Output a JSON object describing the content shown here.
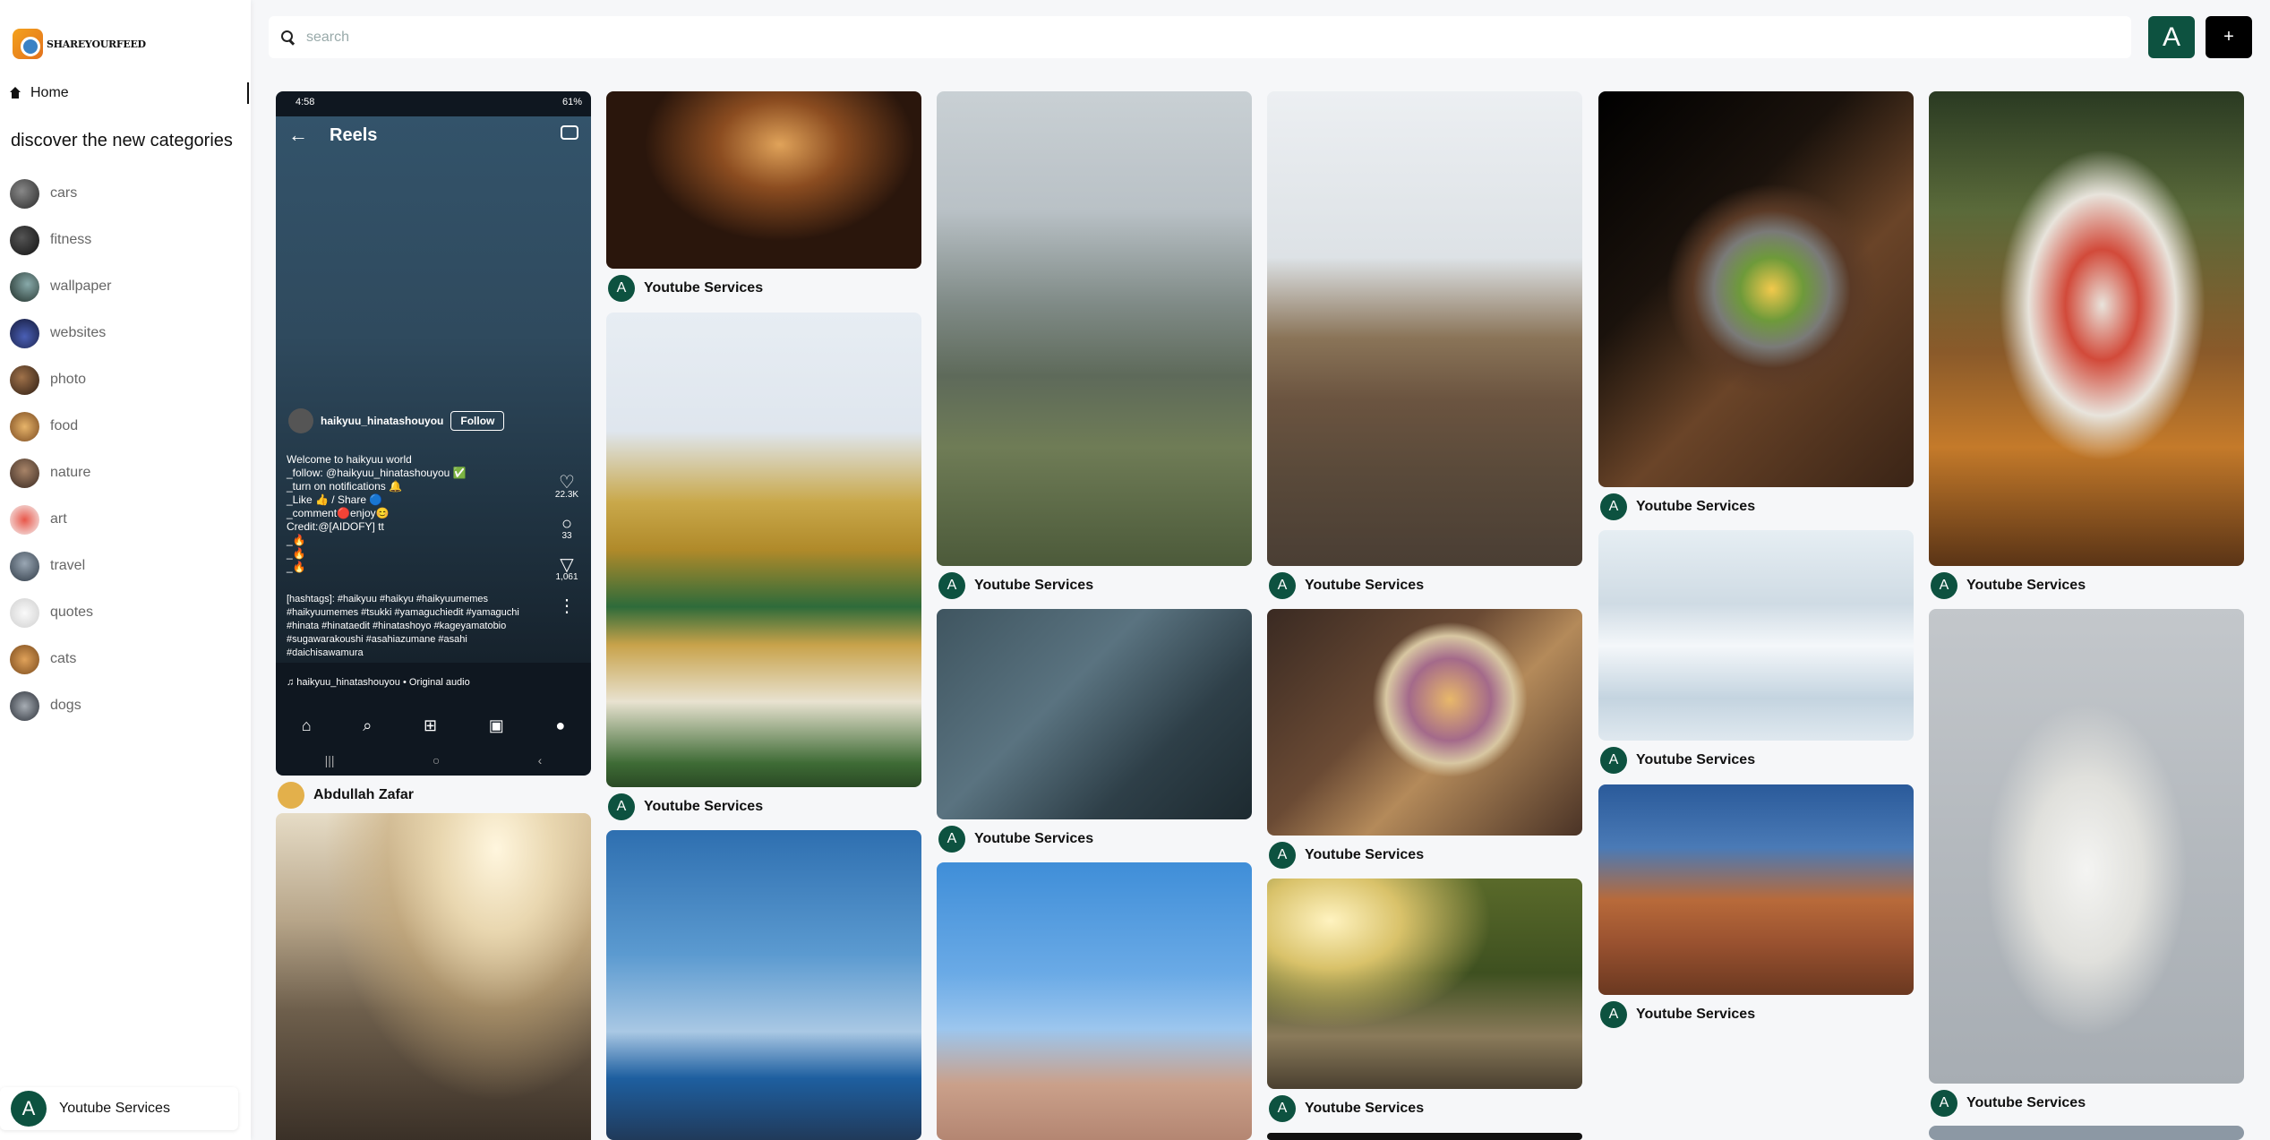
{
  "app": {
    "logo_text": "SHAREYOURFEED"
  },
  "nav": {
    "home_label": "Home"
  },
  "sidebar": {
    "discover_title": "discover the new categories",
    "categories": [
      {
        "label": "cars",
        "color": "#4a4a4a"
      },
      {
        "label": "fitness",
        "color": "#2b2b2b"
      },
      {
        "label": "wallpaper",
        "color": "#3d5a4a"
      },
      {
        "label": "websites",
        "color": "#25305e"
      },
      {
        "label": "photo",
        "color": "#5b3a2a"
      },
      {
        "label": "food",
        "color": "#b7793b"
      },
      {
        "label": "nature",
        "color": "#6a4a3a"
      },
      {
        "label": "art",
        "color": "#c0392b"
      },
      {
        "label": "travel",
        "color": "#4a5a6a"
      },
      {
        "label": "quotes",
        "color": "#e6e6e6"
      },
      {
        "label": "cats",
        "color": "#c78a3e"
      },
      {
        "label": "dogs",
        "color": "#4d5560"
      }
    ],
    "user": {
      "initial": "A",
      "name": "Youtube Services"
    }
  },
  "search": {
    "placeholder": "search"
  },
  "header": {
    "avatar_initial": "A",
    "add_label": "+"
  },
  "feed": {
    "default_owner": {
      "initial": "A",
      "name": "Youtube Services"
    },
    "phone_owner_name": "Abdullah Zafar",
    "phone": {
      "time": "4:58",
      "battery": "61%",
      "title": "Reels",
      "username": "haikyuu_hinatashouyou",
      "follow": "Follow",
      "caption": "Welcome to haikyuu world\n_follow: @haikyuu_hinatashouyou ✅\n_turn on notifications 🔔\n_Like 👍 / Share 🔵\n_comment🔴enjoy😊\nCredit:@[AIDOFY] tt\n_🔥\n_🔥\n_🔥",
      "hashtags": "[hashtags]: #haikyuu #haikyu #haikyuumemes #haikyuumemes #tsukki #yamaguchiedit #yamaguchi #hinata #hinataedit #hinatashoyo #kageyamatobio #sugawarakoushi #asahiazumane #asahi #daichisawamura",
      "likes": "22.3K",
      "comments": "33",
      "shares": "1,061",
      "audio": "♫ haikyuu_hinatashouyou • Original audio"
    }
  }
}
